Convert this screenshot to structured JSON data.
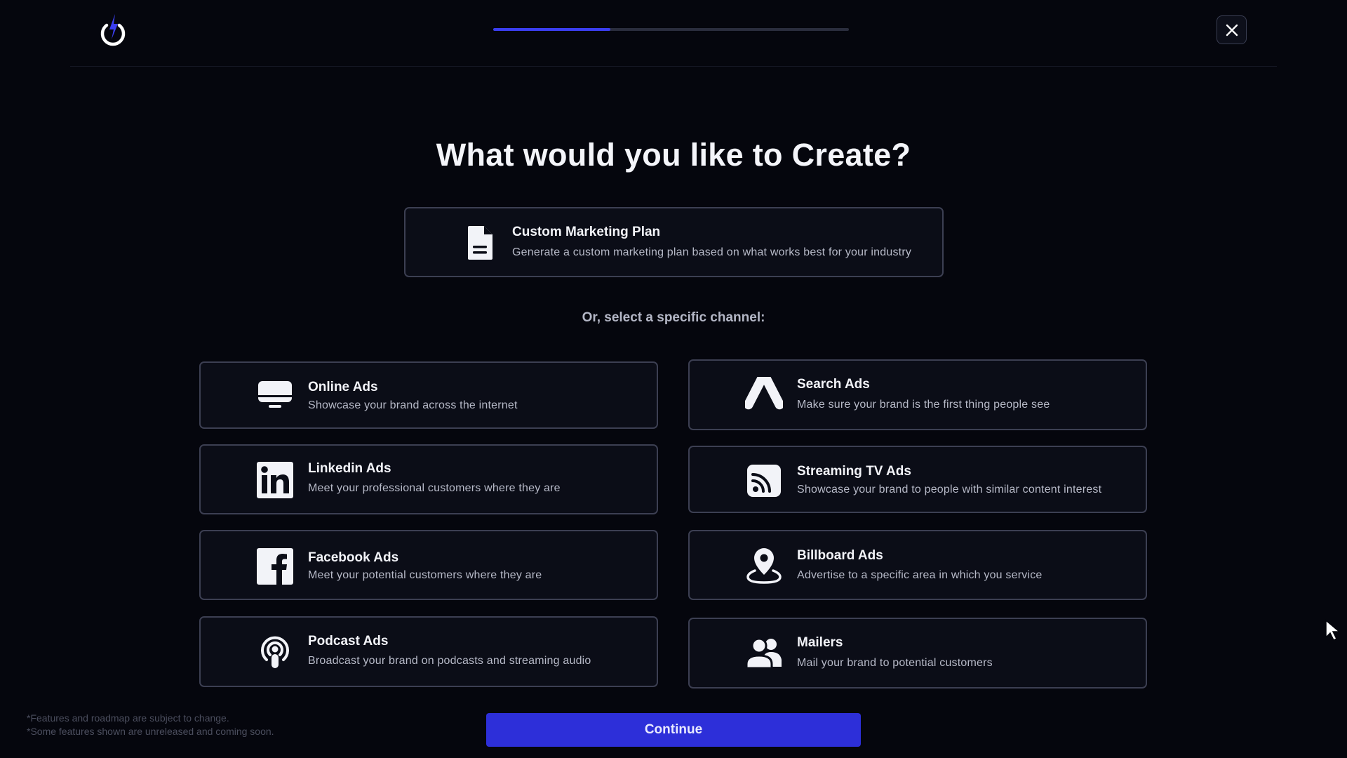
{
  "header": {
    "logo_icon": "power-bolt-logo-icon",
    "progress": 0.33,
    "close_icon": "close-icon"
  },
  "title": "What would you like to Create?",
  "plan_card": {
    "icon": "document-icon",
    "title": "Custom Marketing Plan",
    "description": "Generate a custom marketing plan based on what works best for your industry"
  },
  "subhead": "Or, select a specific channel:",
  "channels": [
    {
      "icon": "monitor-icon",
      "title": "Online Ads",
      "description": "Showcase your brand across the internet"
    },
    {
      "icon": "google-ads-icon",
      "title": "Search Ads",
      "description": "Make sure your brand is the first thing people see"
    },
    {
      "icon": "linkedin-icon",
      "title": "Linkedin Ads",
      "description": "Meet your professional customers where they are"
    },
    {
      "icon": "rss-tv-icon",
      "title": "Streaming TV Ads",
      "description": "Showcase your brand to people with similar content interest"
    },
    {
      "icon": "facebook-icon",
      "title": "Facebook Ads",
      "description": "Meet your potential customers where they are"
    },
    {
      "icon": "location-pin-icon",
      "title": "Billboard Ads",
      "description": "Advertise to a specific area in which you service"
    },
    {
      "icon": "podcast-icon",
      "title": "Podcast Ads",
      "description": "Broadcast your brand on podcasts and streaming audio"
    },
    {
      "icon": "users-icon",
      "title": "Mailers",
      "description": "Mail your brand to potential customers"
    }
  ],
  "footer": {
    "note_1": "*Features and roadmap are subject to change.",
    "note_2": "*Some features shown are unreleased and coming soon.",
    "continue_label": "Continue"
  },
  "colors": {
    "background": "#05060d",
    "accent": "#2d2fd9",
    "progress_fill": "#3b3ef0",
    "card_border": "#3c3f52"
  }
}
